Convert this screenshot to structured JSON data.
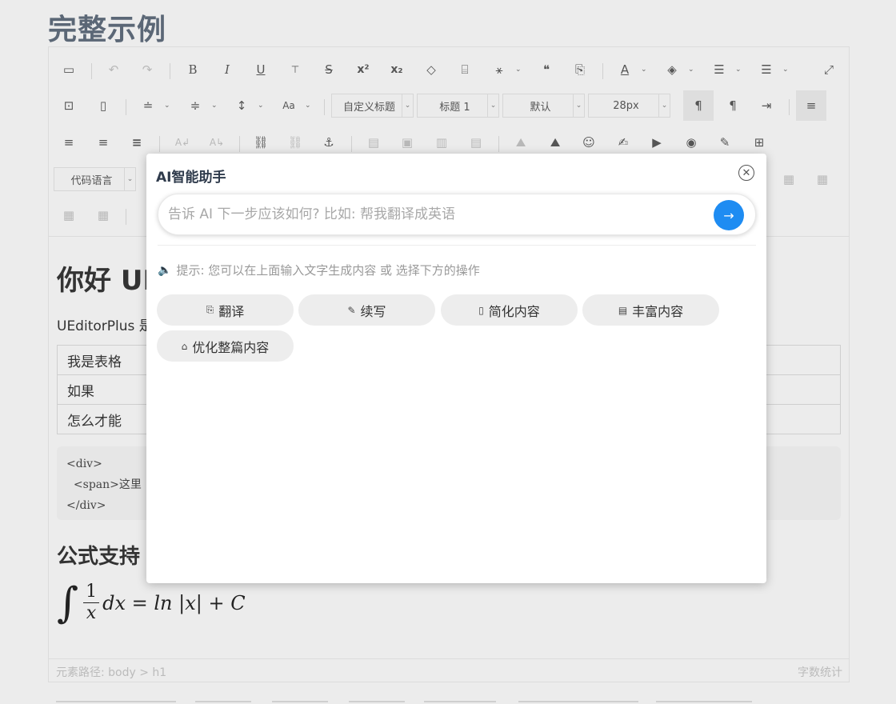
{
  "page": {
    "title": "完整示例"
  },
  "toolbar": {
    "custom_title": "自定义标题",
    "heading": "标题 1",
    "font_family": "默认",
    "font_size": "28px",
    "code_language": "代码语言"
  },
  "content": {
    "heading": "你好 UI",
    "paragraph": "UEditorPlus 是",
    "table_rows": [
      "我是表格",
      "如果",
      "怎么才能"
    ],
    "code_lines": [
      "<div>",
      "  <span>这里",
      "</div>"
    ],
    "formula_heading": "公式支持",
    "formula": {
      "numerator": "1",
      "denominator": "x",
      "rest": "dx = ln |x| + C"
    }
  },
  "statusbar": {
    "path": "元素路径: body > h1",
    "word_count": "字数统计"
  },
  "ai_dialog": {
    "title": "AI智能助手",
    "input_placeholder": "告诉 AI 下一步应该如何? 比如: 帮我翻译成英语",
    "hint": "提示: 您可以在上面输入文字生成内容 或 选择下方的操作",
    "actions": [
      "翻译",
      "续写",
      "简化内容",
      "丰富内容",
      "优化整篇内容"
    ]
  }
}
